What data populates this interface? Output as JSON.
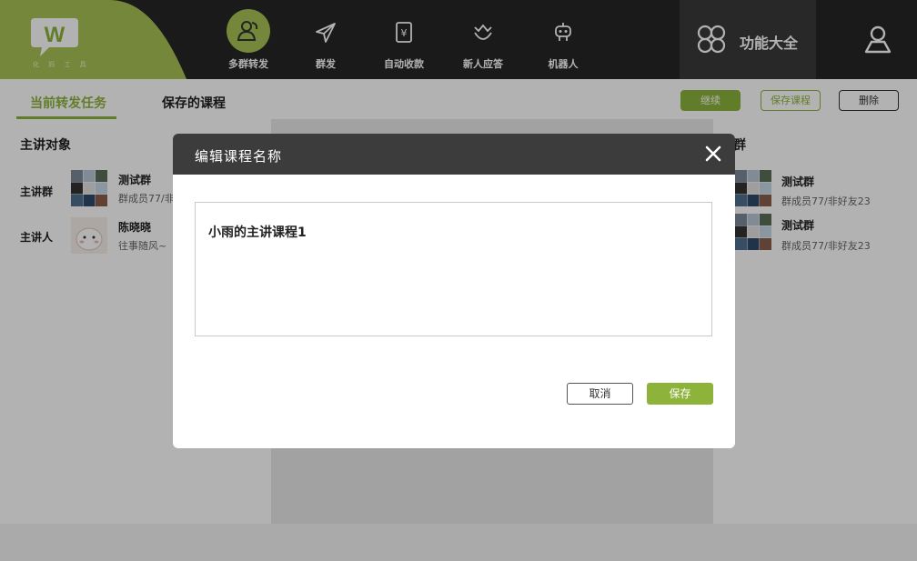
{
  "app": {
    "logo_caption": "化 妈 工 具"
  },
  "nav": {
    "items": [
      {
        "label": "多群转发",
        "icon": "group-share-icon"
      },
      {
        "label": "群发",
        "icon": "send-plane-icon"
      },
      {
        "label": "自动收款",
        "icon": "yen-receipt-icon"
      },
      {
        "label": "新人应答",
        "icon": "crown-smile-icon"
      },
      {
        "label": "机器人",
        "icon": "robot-icon"
      }
    ],
    "functions_label": "功能大全"
  },
  "tabs": {
    "current": "当前转发任务",
    "saved": "保存的课程"
  },
  "actions": {
    "continue": "继续",
    "save_course": "保存课程",
    "delete": "删除"
  },
  "left": {
    "title": "主讲对象",
    "rows": [
      {
        "label": "主讲群",
        "name": "测试群",
        "sub": "群成员77/非"
      },
      {
        "label": "主讲人",
        "name": "陈晓晓",
        "sub": "往事随风~"
      }
    ]
  },
  "right": {
    "title": "发群",
    "items": [
      {
        "name": "测试群",
        "sub": "群成员77/非好友23"
      },
      {
        "name": "测试群",
        "sub": "群成员77/非好友23"
      }
    ]
  },
  "dialog": {
    "title": "编辑课程名称",
    "value": "小雨的主讲课程1",
    "cancel": "取消",
    "save": "保存"
  },
  "colors": {
    "accent": "#8db33b",
    "topbar": "#262626",
    "dialog_header": "#3c3c3c"
  }
}
